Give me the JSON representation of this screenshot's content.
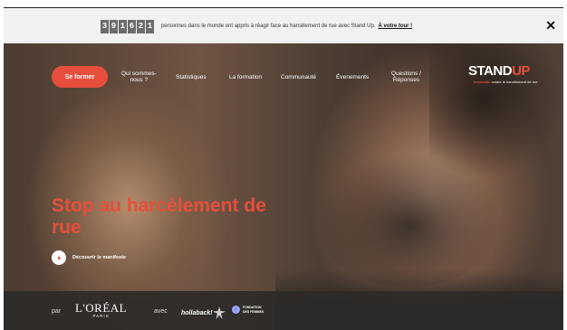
{
  "banner": {
    "counter_digits": [
      "3",
      "9",
      "1",
      "6",
      "2",
      "1"
    ],
    "text": "personnes dans le monde ont appris à réagir face au harcèlement de rue avec Stand Up.",
    "cta": "À votre tour !",
    "close_symbol": "✕"
  },
  "nav": {
    "primary_button": "Se former",
    "items": [
      "Qui sommes-\nnous ?",
      "Statistiques",
      "La formation",
      "Communauté",
      "Évenements",
      "Questions /\nRéponses"
    ]
  },
  "logo": {
    "title_main": "STAND",
    "title_accent": "UP",
    "subtitle_accent": "ensemble",
    "subtitle_rest": "contre le harcèlement de rue"
  },
  "hero": {
    "headline": "Stop au harcèlement de rue",
    "manifesto": "Découvrir le manifeste"
  },
  "footer": {
    "par": "par",
    "loreal_main": "L'ORÉAL",
    "loreal_sub": "PARIS",
    "avec": "avec",
    "hollaback": "hollaback!",
    "fondation_line1": "FONDATION",
    "fondation_line2": "DES FEMMES"
  },
  "colors": {
    "accent": "#e84e3c",
    "banner_bg": "#f1f1f1",
    "footer_bg": "#2d2a28"
  }
}
